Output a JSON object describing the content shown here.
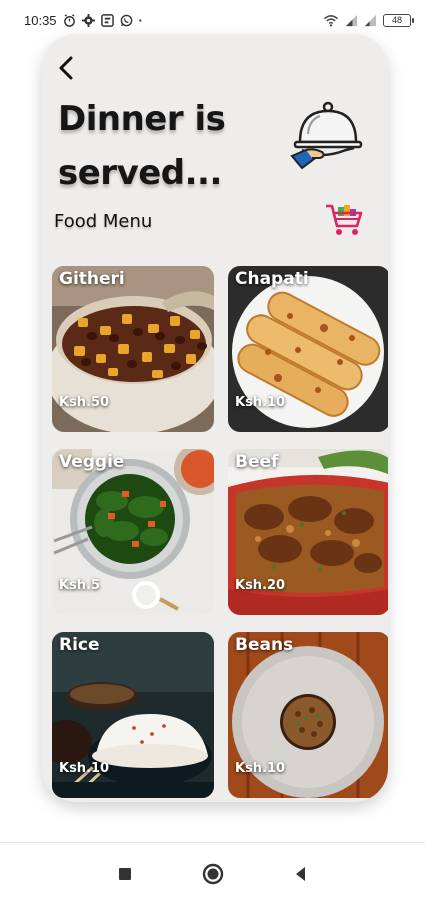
{
  "status_bar": {
    "time": "10:35",
    "battery": "48",
    "dot": "·"
  },
  "header": {
    "title_line1": "Dinner is",
    "title_line2": "served...",
    "menu_heading": "Food Menu"
  },
  "menu": [
    {
      "name": "Githeri",
      "price": "Ksh.50"
    },
    {
      "name": "Chapati",
      "price": "Ksh.10"
    },
    {
      "name": "Veggie",
      "price": "Ksh.5"
    },
    {
      "name": "Beef",
      "price": "Ksh.20"
    },
    {
      "name": "Rice",
      "price": "Ksh.10"
    },
    {
      "name": "Beans",
      "price": "Ksh.10"
    }
  ],
  "icons": {
    "back": "back-arrow-icon",
    "cloche": "serving-cloche-icon",
    "cart": "shopping-cart-icon"
  },
  "colors": {
    "card_bg": "#efedeb",
    "cart_accent": "#e0245e"
  }
}
